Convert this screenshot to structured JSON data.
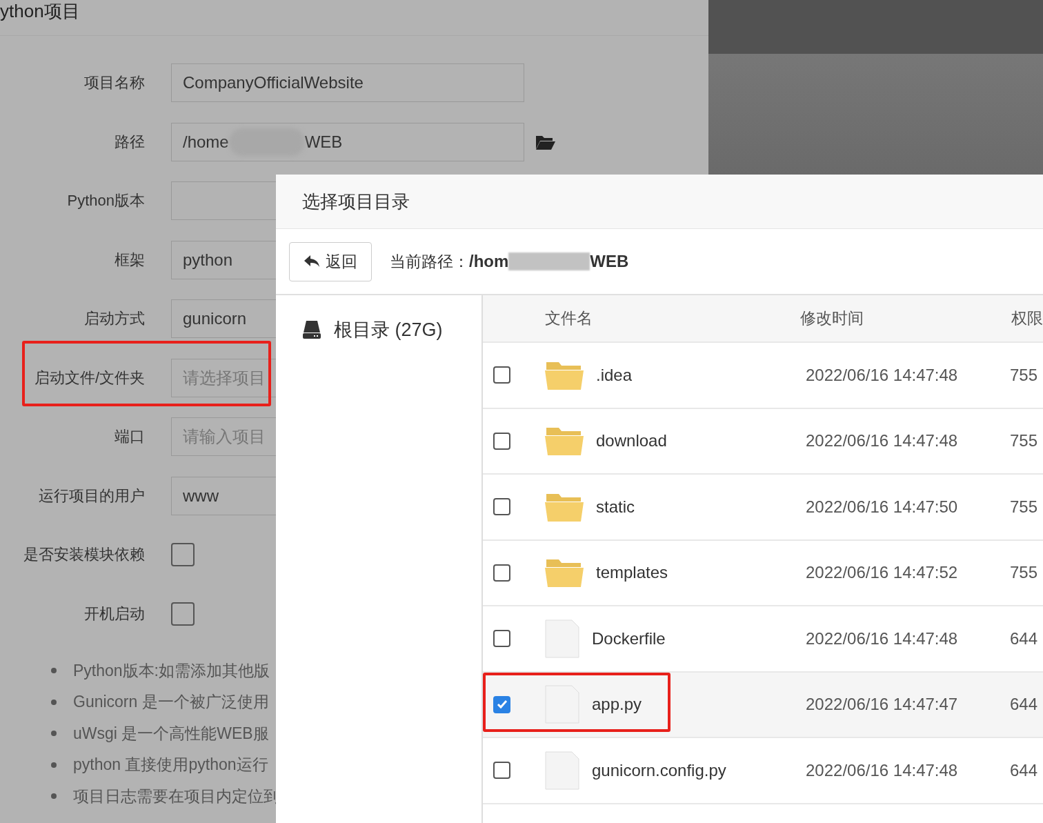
{
  "form": {
    "title": "ython项目",
    "fields": [
      {
        "kind": "text",
        "label": "项目名称",
        "value": "CompanyOfficialWebsite",
        "highlighted": false
      },
      {
        "kind": "path",
        "label": "路径",
        "value": "/home",
        "value_end": "WEB",
        "highlighted": false
      },
      {
        "kind": "text",
        "label": "Python版本",
        "highlighted": false
      },
      {
        "kind": "text",
        "label": "框架",
        "value": "python",
        "highlighted": false
      },
      {
        "kind": "text",
        "label": "启动方式",
        "value": "gunicorn",
        "highlighted": false
      },
      {
        "kind": "text",
        "label": "启动文件/文件夹",
        "placeholder": "请选择项目",
        "highlighted": true
      },
      {
        "kind": "text",
        "label": "端口",
        "placeholder": "请输入项目",
        "highlighted": false
      },
      {
        "kind": "text",
        "label": "运行项目的用户",
        "value": "www",
        "highlighted": false
      },
      {
        "kind": "checkbox",
        "label": "是否安装模块依赖",
        "checked": false,
        "highlighted": false
      },
      {
        "kind": "checkbox",
        "label": "开机启动",
        "checked": false,
        "highlighted": false
      }
    ],
    "notes": [
      "Python版本:如需添加其他版",
      "Gunicorn 是一个被广泛使用",
      "uWsgi 是一个高性能WEB服",
      "python 直接使用python运行",
      "项目日志需要在项目内定位到"
    ]
  },
  "dialog": {
    "title": "选择项目目录",
    "back_button": "返回",
    "path_label": "当前路径：",
    "path_start": "/hom",
    "path_end": "WEB",
    "sidebar": {
      "items": [
        {
          "label": "根目录 (27G)"
        }
      ]
    },
    "table": {
      "columns": [
        "文件名",
        "修改时间",
        "权限"
      ],
      "rows": [
        {
          "kind": "folder",
          "name": ".idea",
          "modified": "2022/06/16 14:47:48",
          "permission": "755",
          "checked": false,
          "highlighted": false
        },
        {
          "kind": "folder",
          "name": "download",
          "modified": "2022/06/16 14:47:48",
          "permission": "755",
          "checked": false,
          "highlighted": false
        },
        {
          "kind": "folder",
          "name": "static",
          "modified": "2022/06/16 14:47:50",
          "permission": "755",
          "checked": false,
          "highlighted": false
        },
        {
          "kind": "folder",
          "name": "templates",
          "modified": "2022/06/16 14:47:52",
          "permission": "755",
          "checked": false,
          "highlighted": false
        },
        {
          "kind": "file",
          "name": "Dockerfile",
          "modified": "2022/06/16 14:47:48",
          "permission": "644",
          "checked": false,
          "highlighted": false
        },
        {
          "kind": "file",
          "name": "app.py",
          "modified": "2022/06/16 14:47:47",
          "permission": "644",
          "checked": true,
          "highlighted": true
        },
        {
          "kind": "file",
          "name": "gunicorn.config.py",
          "modified": "2022/06/16 14:47:48",
          "permission": "644",
          "checked": false,
          "highlighted": false
        }
      ]
    }
  }
}
